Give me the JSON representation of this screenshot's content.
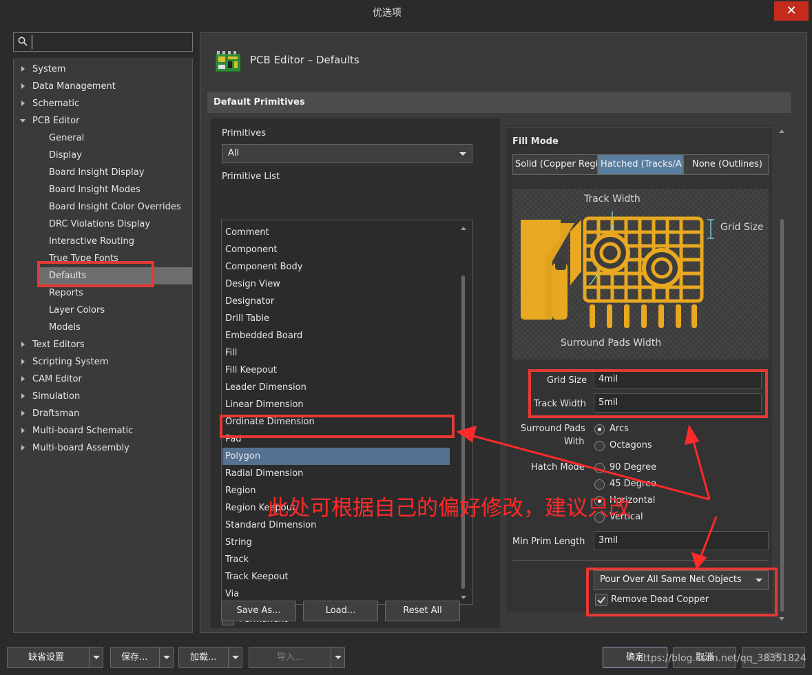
{
  "window": {
    "title": "优选项",
    "close_glyph": "✕"
  },
  "search": {
    "value": "",
    "placeholder": ""
  },
  "tree": {
    "items": [
      {
        "label": "System",
        "level": 0,
        "expanded": false
      },
      {
        "label": "Data Management",
        "level": 0,
        "expanded": false
      },
      {
        "label": "Schematic",
        "level": 0,
        "expanded": false
      },
      {
        "label": "PCB Editor",
        "level": 0,
        "expanded": true
      },
      {
        "label": "General",
        "level": 1
      },
      {
        "label": "Display",
        "level": 1
      },
      {
        "label": "Board Insight Display",
        "level": 1
      },
      {
        "label": "Board Insight Modes",
        "level": 1
      },
      {
        "label": "Board Insight Color Overrides",
        "level": 1
      },
      {
        "label": "DRC Violations Display",
        "level": 1
      },
      {
        "label": "Interactive Routing",
        "level": 1
      },
      {
        "label": "True Type Fonts",
        "level": 1
      },
      {
        "label": "Defaults",
        "level": 1,
        "selected": true
      },
      {
        "label": "Reports",
        "level": 1
      },
      {
        "label": "Layer Colors",
        "level": 1
      },
      {
        "label": "Models",
        "level": 1
      },
      {
        "label": "Text Editors",
        "level": 0,
        "expanded": false
      },
      {
        "label": "Scripting System",
        "level": 0,
        "expanded": false
      },
      {
        "label": "CAM Editor",
        "level": 0,
        "expanded": false
      },
      {
        "label": "Simulation",
        "level": 0,
        "expanded": false
      },
      {
        "label": "Draftsman",
        "level": 0,
        "expanded": false
      },
      {
        "label": "Multi-board Schematic",
        "level": 0,
        "expanded": false
      },
      {
        "label": "Multi-board Assembly",
        "level": 0,
        "expanded": false
      }
    ]
  },
  "page": {
    "title": "PCB Editor – Defaults",
    "section": "Default Primitives"
  },
  "primitives": {
    "label": "Primitives",
    "selected": "All",
    "list_label": "Primitive List",
    "items": [
      "Comment",
      "Component",
      "Component Body",
      "Design View",
      "Designator",
      "Drill Table",
      "Embedded Board",
      "Fill",
      "Fill Keepout",
      "Leader Dimension",
      "Linear Dimension",
      "Ordinate Dimension",
      "Pad",
      "Polygon",
      "Radial Dimension",
      "Region",
      "Region Keepout",
      "Standard Dimension",
      "String",
      "Track",
      "Track Keepout",
      "Via"
    ],
    "selected_item": "Polygon",
    "permanent_label": "Permanent",
    "permanent_checked": false,
    "save_as": "Save As...",
    "load": "Load...",
    "reset_all": "Reset All"
  },
  "fill_mode": {
    "heading": "Fill Mode",
    "options": [
      "Solid (Copper Regio",
      "Hatched (Tracks/Arc",
      "None (Outlines)"
    ],
    "selected_index": 1,
    "diagram": {
      "track_width": "Track Width",
      "grid_size": "Grid Size",
      "surround": "Surround Pads Width"
    },
    "grid_size_label": "Grid Size",
    "grid_size_value": "4mil",
    "track_width_label": "Track Width",
    "track_width_value": "5mil",
    "surround_label_1": "Surround Pads",
    "surround_label_2": "With",
    "surround_options": [
      "Arcs",
      "Octagons"
    ],
    "surround_selected": 0,
    "hatch_label": "Hatch Mode",
    "hatch_options": [
      "90 Degree",
      "45 Degree",
      "Horizontal",
      "Vertical"
    ],
    "hatch_selected": 2,
    "min_prim_label": "Min Prim Length",
    "min_prim_value": "3mil",
    "pour_over": "Pour Over All Same Net Objects",
    "remove_dead_label": "Remove Dead Copper",
    "remove_dead_checked": true
  },
  "annotation": {
    "text": "此处可根据自己的偏好修改，建议只改"
  },
  "bottom": {
    "defaults_btn": "缺省设置",
    "save_btn": "保存...",
    "load_btn": "加载...",
    "import_btn": "导入...",
    "ok_btn": "确定",
    "cancel_btn": "取消",
    "apply_btn": "应用"
  },
  "watermark": "https://blog.csdn.net/qq_38351824",
  "colors": {
    "accent": "#557090",
    "annotation_red": "#e53935",
    "pcb_yellow": "#e8a820"
  }
}
